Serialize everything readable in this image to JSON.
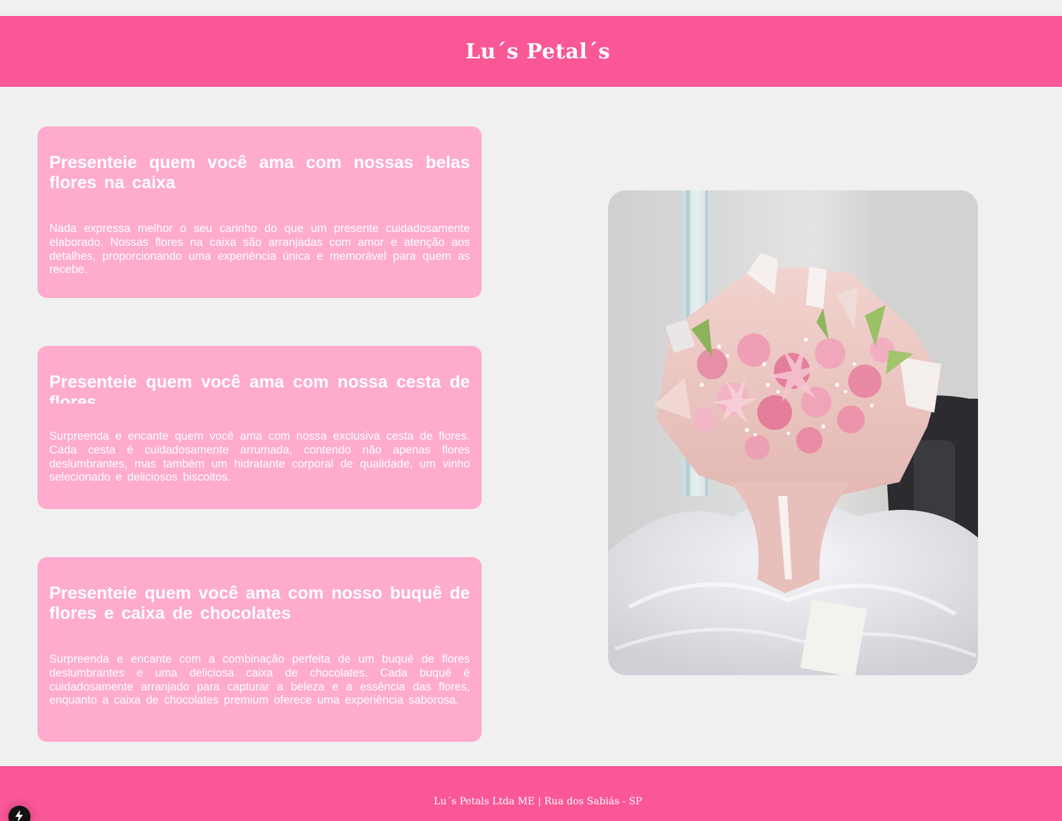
{
  "header": {
    "title": "Lu´s Petal´s"
  },
  "cards": [
    {
      "title": "Presenteie quem você ama com nossas belas flores na caixa",
      "text": "Nada expressa melhor o seu carinho do que um presente cuidadosamente elaborado. Nossas flores na caixa são arranjadas com amor e atenção aos detalhes, proporcionando uma experiência única e memorável para quem as recebe."
    },
    {
      "title": "Presenteie quem você ama com nossa cesta de flores",
      "text": "Surpreenda e encante quem você ama com nossa exclusiva cesta de flores. Cada cesta é cuidadosamente arrumada, contendo não apenas flores deslumbrantes, mas também um hidratante corporal de qualidade, um vinho selecionado e deliciosos biscoitos."
    },
    {
      "title": "Presenteie quem você ama com nosso buquê de flores e caixa de chocolates",
      "text": "Surpreenda e encante com a combinação perfeita de um buquê de flores deslumbrantes e uma deliciosa caixa de chocolates. Cada buquê é cuidadosamente arranjado para capturar a beleza e a essência das flores, enquanto a caixa de chocolates premium oferece uma experiência saborosa."
    }
  ],
  "photo": {
    "subject": "pink lily and rose bouquet wrapped in pink paper on white tulle"
  },
  "footer": {
    "text": "Lu´s Petals Ltda ME | Rua dos Sabiás - SP"
  },
  "colors": {
    "header_bg": "#fa5796",
    "card_bg": "#feabcd",
    "page_bg": "#f0f0f0",
    "text": "#ffffff"
  },
  "icons": {
    "dev_badge": "lightning-bolt-icon"
  }
}
